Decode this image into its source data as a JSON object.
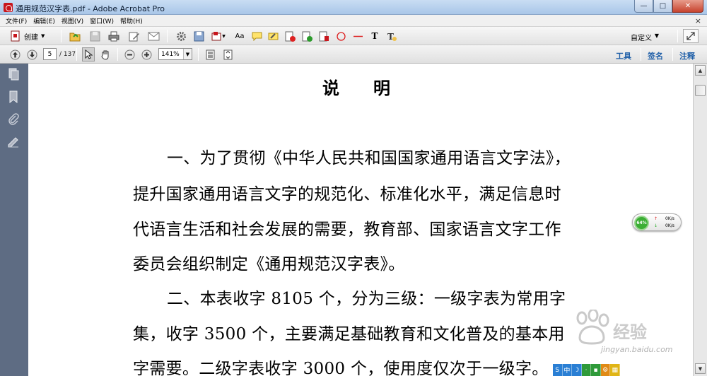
{
  "window": {
    "title": "通用规范汉字表.pdf - Adobe Acrobat Pro",
    "minimize": "—",
    "maximize": "□",
    "close": "✕"
  },
  "menu": {
    "items": [
      "文件(F)",
      "编辑(E)",
      "视图(V)",
      "窗口(W)",
      "帮助(H)"
    ],
    "close_doc": "×"
  },
  "toolbar": {
    "create_label": "创建",
    "custom_label": "自定义"
  },
  "navigation": {
    "current_page": "5",
    "total_pages": "/ 137",
    "zoom": "141%"
  },
  "panes": {
    "tools": "工具",
    "sign": "签名",
    "comment": "注释"
  },
  "document": {
    "heading": "说明",
    "lines": [
      "一、为了贯彻《中华人民共和国国家通用语言文字法》，",
      "提升国家通用语言文字的规范化、标准化水平，满足信息时",
      "代语言生活和社会发展的需要，教育部、国家语言文字工作",
      "委员会组织制定《通用规范汉字表》。",
      "二、本表收字 8105 个，分为三级：一级字表为常用字",
      "集，收字 3500 个，主要满足基础教育和文化普及的基本用",
      "字需要。二级字表收字 3000 个，使用度仅次于一级字。"
    ]
  },
  "net_monitor": {
    "percent": "64%",
    "up_arrow": "↑",
    "down_arrow": "↓",
    "upload_rate": "0K/s",
    "download_rate": "0K/s"
  },
  "watermark": {
    "brand": "经验",
    "url": "jingyan.baidu.com"
  },
  "ime_bar": {
    "items": [
      "S",
      "中",
      "☽",
      "·",
      "▪",
      "⚙",
      "▦"
    ],
    "colors": [
      "#2a7fd4",
      "#2a7fd4",
      "#2a7fd4",
      "#2f9a3a",
      "#2f9a3a",
      "#e08a16",
      "#e0b516"
    ]
  }
}
